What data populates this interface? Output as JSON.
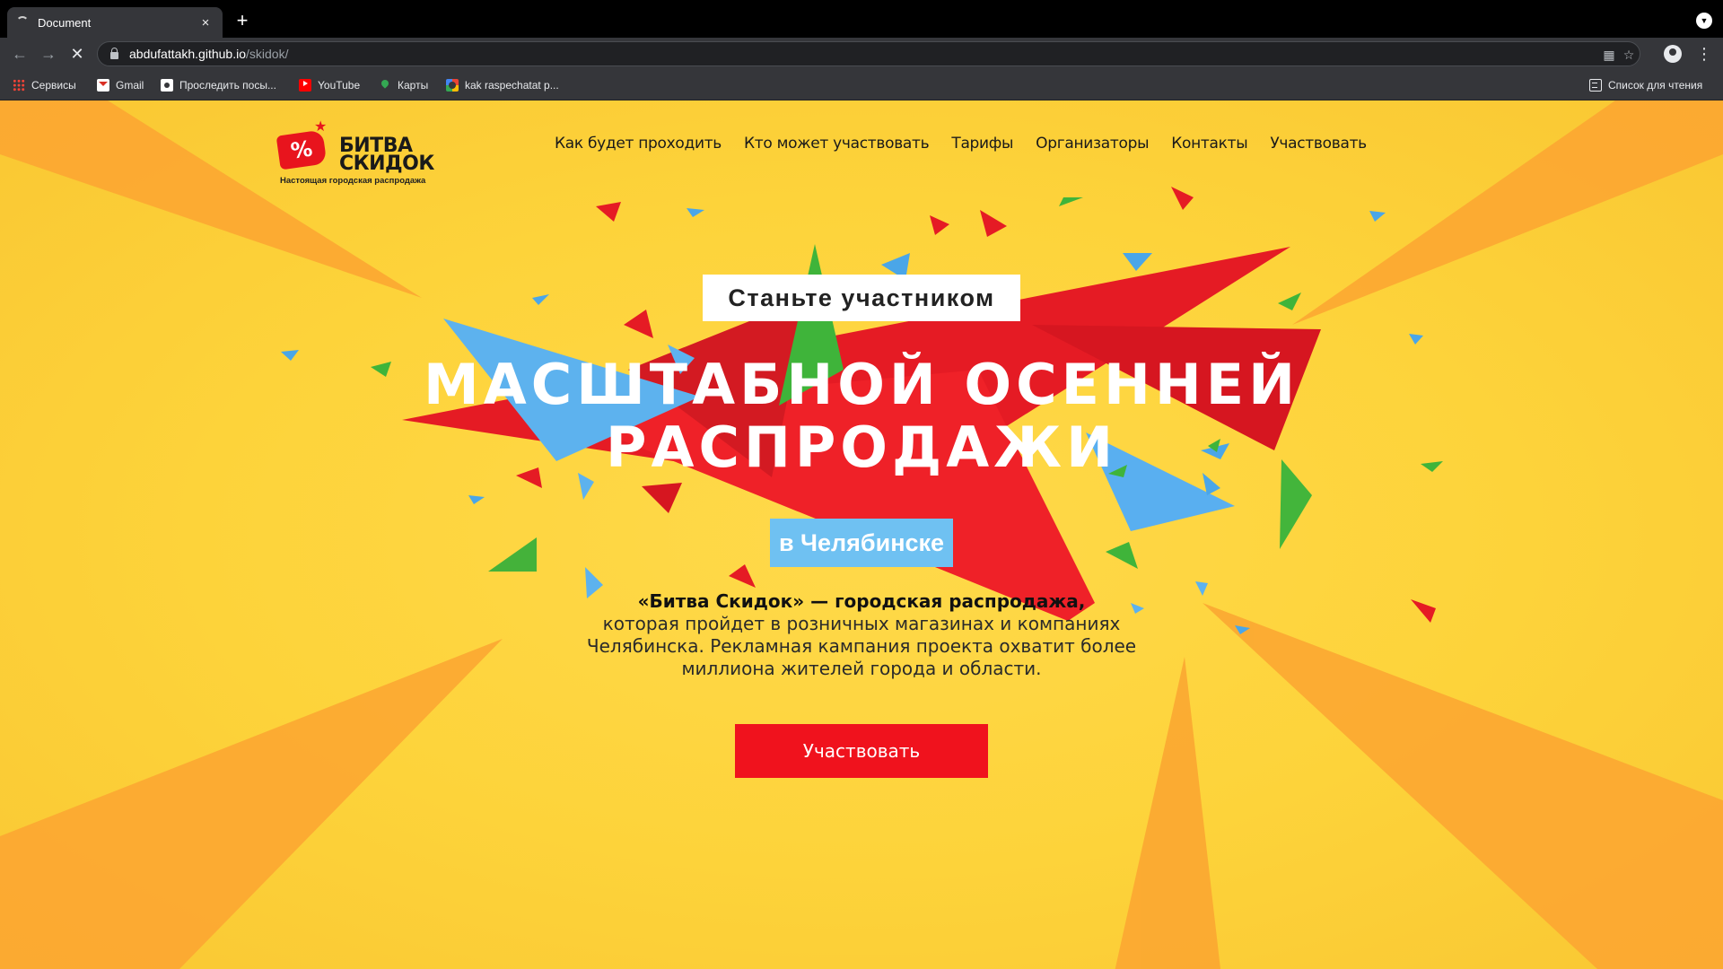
{
  "browser": {
    "tab_title": "Document",
    "tab_close": "×",
    "new_tab": "+",
    "url_host": "abdufattakh.github.io",
    "url_path": "/skidok/",
    "bookmarks": [
      {
        "label": "Сервисы",
        "icon": "apps-grid-icon"
      },
      {
        "label": "Gmail",
        "icon": "gmail-icon"
      },
      {
        "label": "Проследить посы...",
        "icon": "tracking-icon"
      },
      {
        "label": "YouTube",
        "icon": "youtube-icon"
      },
      {
        "label": "Карты",
        "icon": "maps-icon"
      },
      {
        "label": "kak raspechatat p...",
        "icon": "google-icon"
      }
    ],
    "reading_list": "Список для чтения"
  },
  "logo": {
    "line1": "БИТВА",
    "line2": "СКИДОК",
    "badge": "%",
    "subtitle": "Настоящая городская распродажа"
  },
  "nav": {
    "items": [
      "Как будет проходить",
      "Кто может участвовать",
      "Тарифы",
      "Организаторы",
      "Контакты",
      "Участвовать"
    ]
  },
  "hero": {
    "tag": "Станьте участником",
    "title_line1": "МАСШТАБНОЙ ОСЕННЕЙ",
    "title_line2": "РАСПРОДАЖИ",
    "city": "в Челябинске",
    "desc_bold": "«Битва Скидок» — городская распродажа,",
    "desc_rest": "которая пройдет в розничных магазинах и компаниях Челябинска.  Рекламная кампания проекта охватит более миллиона жителей  города и области.",
    "cta": "Участвовать"
  },
  "colors": {
    "background": "#fdd33a",
    "accent_red": "#f0121d",
    "accent_blue": "#6fc1f2",
    "accent_green": "#3fb43a",
    "ray_orange": "#fba531"
  }
}
